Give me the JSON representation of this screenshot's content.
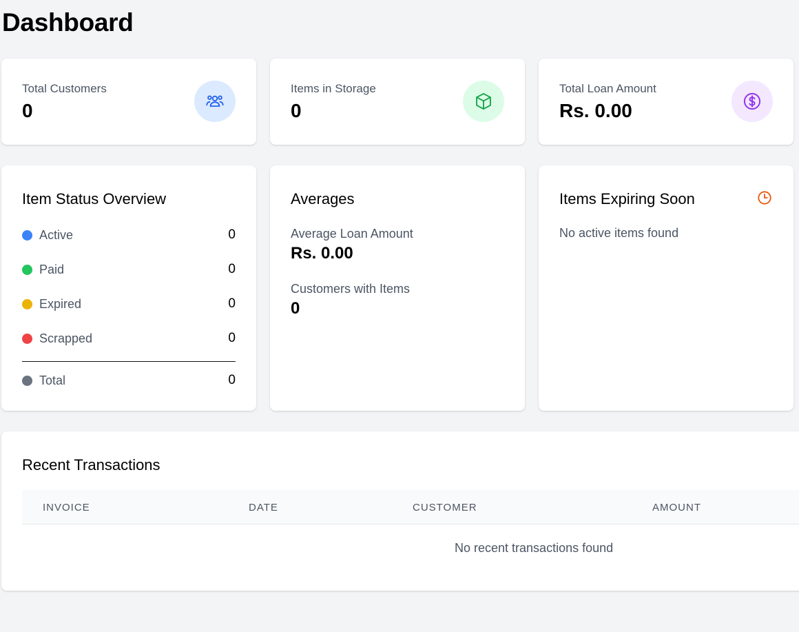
{
  "page": {
    "title": "Dashboard"
  },
  "stats": [
    {
      "label": "Total Customers",
      "value": "0",
      "icon": "users-icon",
      "icon_bg": "#dbeafe",
      "icon_color": "#2563eb"
    },
    {
      "label": "Items in Storage",
      "value": "0",
      "icon": "box-icon",
      "icon_bg": "#dcfce7",
      "icon_color": "#16a34a"
    },
    {
      "label": "Total Loan Amount",
      "value": "Rs. 0.00",
      "icon": "dollar-icon",
      "icon_bg": "#f3e8ff",
      "icon_color": "#9333ea"
    }
  ],
  "status_overview": {
    "title": "Item Status Overview",
    "items": [
      {
        "label": "Active",
        "count": "0",
        "color": "#3b82f6"
      },
      {
        "label": "Paid",
        "count": "0",
        "color": "#22c55e"
      },
      {
        "label": "Expired",
        "count": "0",
        "color": "#eab308"
      },
      {
        "label": "Scrapped",
        "count": "0",
        "color": "#ef4444"
      }
    ],
    "total": {
      "label": "Total",
      "count": "0",
      "color": "#6b7280"
    }
  },
  "averages": {
    "title": "Averages",
    "avg_loan_label": "Average Loan Amount",
    "avg_loan_value": "Rs. 0.00",
    "customers_label": "Customers with Items",
    "customers_value": "0"
  },
  "expiring": {
    "title": "Items Expiring Soon",
    "icon": "clock-icon",
    "icon_color": "#ea580c",
    "empty_text": "No active items found"
  },
  "transactions": {
    "title": "Recent Transactions",
    "columns": [
      "INVOICE",
      "DATE",
      "CUSTOMER",
      "AMOUNT"
    ],
    "empty_text": "No recent transactions found"
  }
}
